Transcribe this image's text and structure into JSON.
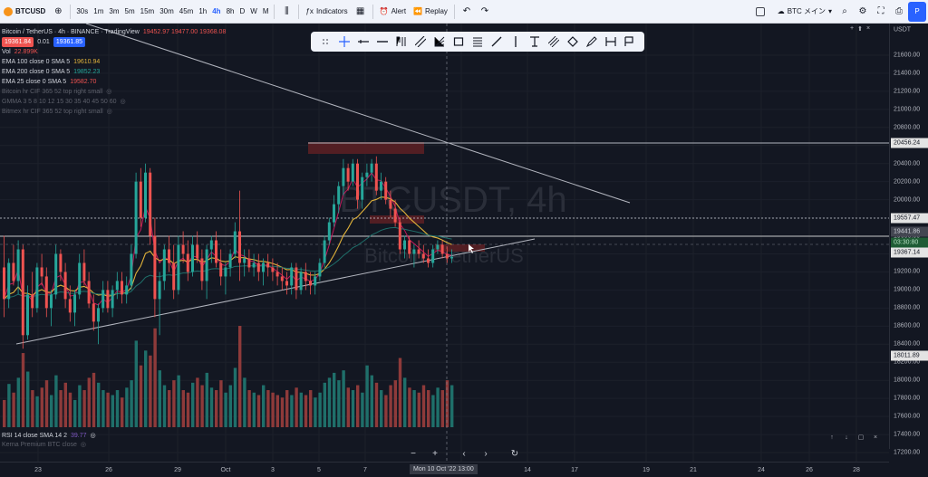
{
  "topbar": {
    "symbol": "BTCUSD",
    "add_icon": "plus-circle-icon",
    "timeframes": [
      "30s",
      "1m",
      "3m",
      "5m",
      "15m",
      "30m",
      "45m",
      "1h",
      "4h",
      "8h",
      "D",
      "W",
      "M"
    ],
    "active_timeframe": "4h",
    "indicators_label": "Indicators",
    "alert_label": "Alert",
    "replay_label": "Replay",
    "layout_name": "BTC メイン",
    "publish_label": "P"
  },
  "legend": {
    "title": "Bitcoin / TetherUS · 4h · BINANCE · TradingView",
    "ohlc": "19452.97  19477.00  19368.08",
    "bid": "19361.84",
    "spread": "0.01",
    "ask": "19361.85",
    "vol_label": "Vol",
    "vol_value": "22.899K",
    "ema100_label": "EMA 100 close 0 SMA 5",
    "ema100_value": "19610.94",
    "ema200_label": "EMA 200 close 0 SMA 5",
    "ema200_value": "19852.23",
    "ema25_label": "EMA 25 close 0 SMA 5",
    "ema25_value": "19582.70",
    "faint1": "Bitcoin hr CIF 365 52 top right small",
    "faint2": "GMMA 3 5 8 10 12 15 30 35 40 45 50 60",
    "faint3": "Bitmex hr CIF 365 52 top right small"
  },
  "watermark": {
    "symbol": "BTCUSDT, 4h",
    "name": "Bitcoin / TetherUS"
  },
  "price_axis": {
    "currency": "USDT",
    "ticks": [
      "21600.00",
      "21400.00",
      "21200.00",
      "21000.00",
      "20800.00",
      "20600.00",
      "20400.00",
      "20200.00",
      "20000.00",
      "19800.00",
      "19600.00",
      "19400.00",
      "19200.00",
      "19000.00",
      "18800.00",
      "18600.00",
      "18400.00",
      "18200.00",
      "18000.00",
      "17800.00",
      "17600.00",
      "17400.00",
      "17200.00"
    ],
    "tag_upper": "20456.24",
    "tag_mid": "19557.47",
    "tag_ema": "19441.86",
    "tag_countdown": "03:30:80",
    "tag_last": "19367.14",
    "tag_low": "18011.89"
  },
  "time_axis": {
    "labels": [
      "23",
      "26",
      "29",
      "Oct",
      "3",
      "5",
      "7",
      "11",
      "14",
      "17",
      "19",
      "21",
      "24",
      "26",
      "28"
    ],
    "cursor": "Mon 10 Oct '22   13:00"
  },
  "rsi": {
    "label": "RSI 14 close SMA 14 2",
    "value": "39.77",
    "faint": "Kerna Premium BTC close"
  },
  "colors": {
    "up": "#26a69a",
    "down": "#ef5350",
    "ema100": "#e0b23a",
    "ema200": "#1f6f6a",
    "ema25": "#c2185b",
    "accent": "#2962ff"
  },
  "chart_data": {
    "type": "candlestick",
    "ylim": [
      17100,
      21750
    ],
    "candles": [
      [
        19250,
        19600,
        18700,
        18900
      ],
      [
        18900,
        19350,
        18800,
        19300
      ],
      [
        19300,
        19500,
        19050,
        19100
      ],
      [
        19100,
        19550,
        18950,
        19450
      ],
      [
        19450,
        19500,
        18350,
        18500
      ],
      [
        18500,
        19050,
        18450,
        18950
      ],
      [
        18950,
        19200,
        18700,
        18800
      ],
      [
        18800,
        19300,
        18750,
        19250
      ],
      [
        19250,
        19400,
        19050,
        19150
      ],
      [
        19150,
        19250,
        18700,
        18800
      ],
      [
        18800,
        19000,
        18600,
        18950
      ],
      [
        18950,
        19500,
        18900,
        19400
      ],
      [
        19400,
        19450,
        19100,
        19200
      ],
      [
        19200,
        19300,
        18800,
        18900
      ],
      [
        18900,
        19050,
        18650,
        18750
      ],
      [
        18750,
        19000,
        18600,
        18950
      ],
      [
        18950,
        19400,
        18900,
        19300
      ],
      [
        19300,
        19450,
        19050,
        19100
      ],
      [
        19100,
        19200,
        18800,
        18850
      ],
      [
        18850,
        18950,
        18550,
        18650
      ],
      [
        18650,
        18850,
        18400,
        18800
      ],
      [
        18800,
        19100,
        18750,
        19000
      ],
      [
        19000,
        19100,
        18750,
        18800
      ],
      [
        18800,
        19050,
        18700,
        19000
      ],
      [
        19000,
        19200,
        18900,
        19100
      ],
      [
        19100,
        19200,
        18850,
        18950
      ],
      [
        18950,
        19150,
        18850,
        19050
      ],
      [
        19050,
        19500,
        19000,
        19400
      ],
      [
        19400,
        20300,
        19350,
        20200
      ],
      [
        20200,
        20350,
        19700,
        19800
      ],
      [
        19800,
        20400,
        19750,
        20300
      ],
      [
        20300,
        20350,
        19500,
        19600
      ],
      [
        19600,
        19800,
        18700,
        18900
      ],
      [
        18900,
        19200,
        18500,
        19100
      ],
      [
        19100,
        19500,
        19000,
        19450
      ],
      [
        19450,
        19600,
        19200,
        19300
      ],
      [
        19300,
        19500,
        18900,
        19000
      ],
      [
        19000,
        19600,
        18950,
        19500
      ],
      [
        19500,
        19650,
        19300,
        19400
      ],
      [
        19400,
        19550,
        19100,
        19200
      ],
      [
        19200,
        19600,
        19150,
        19500
      ],
      [
        19500,
        19650,
        19300,
        19350
      ],
      [
        19350,
        19450,
        19000,
        19100
      ],
      [
        19100,
        19500,
        18900,
        19450
      ],
      [
        19450,
        19600,
        19300,
        19550
      ],
      [
        19550,
        19650,
        19250,
        19300
      ],
      [
        19300,
        19450,
        19050,
        19150
      ],
      [
        19150,
        19300,
        18950,
        19250
      ],
      [
        19250,
        19450,
        19150,
        19400
      ],
      [
        19400,
        19750,
        19350,
        19650
      ],
      [
        19650,
        20100,
        19100,
        19300
      ],
      [
        19300,
        19450,
        19150,
        19350
      ],
      [
        19350,
        19450,
        19200,
        19250
      ],
      [
        19250,
        19400,
        19150,
        19300
      ],
      [
        19300,
        19400,
        19100,
        19200
      ],
      [
        19200,
        19350,
        19050,
        19300
      ],
      [
        19300,
        19400,
        19150,
        19250
      ],
      [
        19250,
        19350,
        19100,
        19200
      ],
      [
        19200,
        19300,
        19050,
        19150
      ],
      [
        19150,
        19250,
        19000,
        19100
      ],
      [
        19100,
        19200,
        18950,
        19050
      ],
      [
        19050,
        19300,
        18950,
        19250
      ],
      [
        19250,
        19300,
        18900,
        19000
      ],
      [
        19000,
        19250,
        18950,
        19200
      ],
      [
        19200,
        19300,
        19000,
        19100
      ],
      [
        19100,
        19200,
        18950,
        19050
      ],
      [
        19050,
        19200,
        18950,
        19150
      ],
      [
        19150,
        19350,
        19100,
        19300
      ],
      [
        19300,
        19600,
        19250,
        19550
      ],
      [
        19550,
        19800,
        19500,
        19750
      ],
      [
        19750,
        20050,
        19700,
        19950
      ],
      [
        19950,
        20200,
        19850,
        20150
      ],
      [
        20150,
        20450,
        20050,
        20350
      ],
      [
        20350,
        20400,
        20100,
        20200
      ],
      [
        20200,
        20450,
        20150,
        20400
      ],
      [
        20400,
        20450,
        19900,
        20000
      ],
      [
        20000,
        20300,
        19900,
        20250
      ],
      [
        20250,
        20400,
        20150,
        20300
      ],
      [
        20300,
        20450,
        20200,
        20400
      ],
      [
        20400,
        20480,
        20050,
        20100
      ],
      [
        20100,
        20300,
        20000,
        20200
      ],
      [
        20200,
        20250,
        19950,
        20000
      ],
      [
        20000,
        20100,
        19800,
        19900
      ],
      [
        19900,
        20000,
        19700,
        19750
      ],
      [
        19750,
        19800,
        19400,
        19450
      ],
      [
        19450,
        19600,
        19350,
        19550
      ],
      [
        19550,
        19600,
        19350,
        19400
      ],
      [
        19400,
        19500,
        19250,
        19450
      ],
      [
        19450,
        19550,
        19350,
        19400
      ],
      [
        19400,
        19500,
        19300,
        19350
      ],
      [
        19350,
        19450,
        19250,
        19300
      ],
      [
        19300,
        19500,
        19250,
        19450
      ],
      [
        19450,
        19550,
        19400,
        19500
      ],
      [
        19500,
        19550,
        19350,
        19400
      ],
      [
        19400,
        19480,
        19300,
        19350
      ],
      [
        19350,
        19450,
        19300,
        19367
      ]
    ],
    "volumes": [
      22,
      35,
      28,
      40,
      60,
      45,
      30,
      25,
      32,
      38,
      26,
      42,
      30,
      36,
      28,
      22,
      34,
      30,
      40,
      44,
      36,
      30,
      28,
      26,
      30,
      24,
      32,
      38,
      70,
      50,
      62,
      58,
      80,
      46,
      34,
      30,
      38,
      42,
      30,
      28,
      36,
      40,
      34,
      44,
      32,
      30,
      38,
      28,
      34,
      48,
      82,
      40,
      30,
      28,
      26,
      34,
      30,
      28,
      26,
      24,
      30,
      26,
      32,
      28,
      26,
      30,
      24,
      28,
      36,
      40,
      44,
      38,
      46,
      32,
      30,
      34,
      28,
      50,
      42,
      36,
      30,
      26,
      34,
      38,
      56,
      40,
      32,
      30,
      28,
      34,
      30,
      26,
      32,
      30,
      38,
      34
    ]
  }
}
